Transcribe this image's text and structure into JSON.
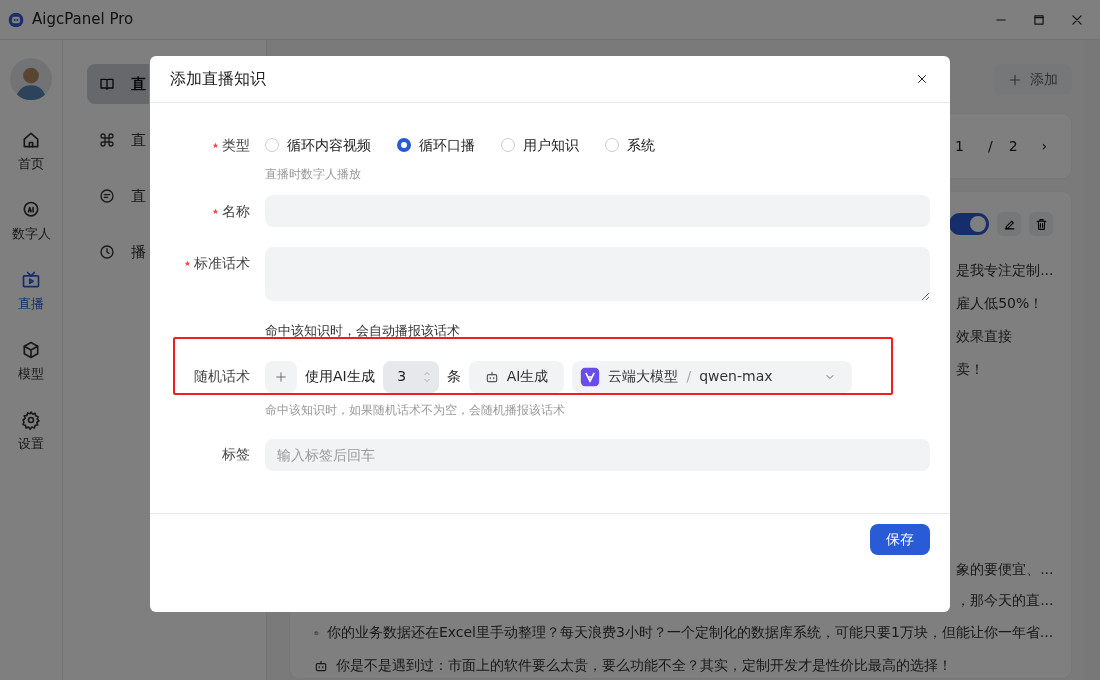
{
  "window": {
    "title": "AigcPanel Pro"
  },
  "nav": {
    "items": [
      {
        "label": "首页",
        "selected": false
      },
      {
        "label": "数字人",
        "selected": false
      },
      {
        "label": "直播",
        "selected": true
      },
      {
        "label": "模型",
        "selected": false
      },
      {
        "label": "设置",
        "selected": false
      }
    ]
  },
  "submenu": {
    "items": [
      {
        "label": "直",
        "selected": true
      },
      {
        "label": "直",
        "selected": false
      },
      {
        "label": "直",
        "selected": false
      },
      {
        "label": "播",
        "selected": false
      }
    ]
  },
  "main": {
    "add_button": "添加",
    "pagination": {
      "current": "1",
      "separator": "/",
      "total": "2",
      "next": "›"
    },
    "card": {
      "enabled": true,
      "fragments": [
        "是我专注定制...",
        "雇人低50%！",
        "效果直接",
        "卖！"
      ],
      "lower_fragments": [
        "象的要便宜、...",
        "，那今天的直..."
      ],
      "rows": [
        "你的业务数据还在Excel里手动整理？每天浪费3小时？一个定制化的数据库系统，可能只要1万块，但能让你一年省...",
        "你是不是遇到过：市面上的软件要么太贵，要么功能不全？其实，定制开发才是性价比最高的选择！"
      ]
    }
  },
  "dialog": {
    "title": "添加直播知识",
    "fields": [
      {
        "kind": "radio",
        "label": "类型",
        "required": true,
        "options": [
          {
            "label": "循环内容视频",
            "selected": false
          },
          {
            "label": "循环口播",
            "selected": true
          },
          {
            "label": "用户知识",
            "selected": false
          },
          {
            "label": "系统",
            "selected": false
          }
        ],
        "help": "直播时数字人播放"
      },
      {
        "kind": "input",
        "label": "名称",
        "required": true
      },
      {
        "kind": "textarea",
        "label": "标准话术",
        "required": true,
        "help": "命中该知识时，会自动播报该话术"
      },
      {
        "kind": "random",
        "label": "随机话术",
        "required": false,
        "highlighted": true,
        "use_ai": "使用AI生成",
        "count": "3",
        "unit": "条",
        "ai_button": "AI生成",
        "model_provider": "云端大模型",
        "model_separator": "/",
        "model_name": "qwen-max",
        "help": "命中该知识时，如果随机话术不为空，会随机播报该话术"
      },
      {
        "kind": "input",
        "label": "标签",
        "required": false,
        "placeholder": "输入标签后回车"
      }
    ],
    "save": "保存"
  }
}
